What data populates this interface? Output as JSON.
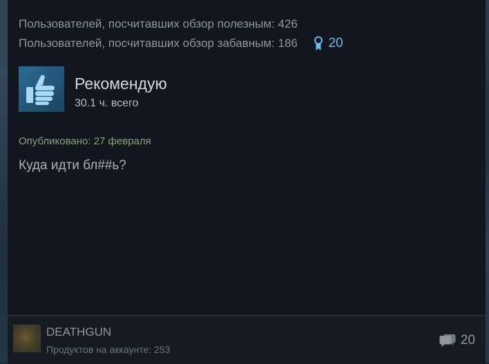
{
  "votes": {
    "helpful": "Пользователей, посчитавших обзор полезным: 426",
    "funny": "Пользователей, посчитавших обзор забавным: 186",
    "awards_count": "20",
    "award_icon": "award-ribbon-icon"
  },
  "verdict": {
    "label": "Рекомендую",
    "hours": "30.1 ч. всего",
    "icon": "thumbs-up-icon"
  },
  "review": {
    "posted": "Опубликовано: 27 февраля",
    "body": "Куда идти бл##ь?"
  },
  "author": {
    "name": "DEATHGUN",
    "products": "Продуктов на аккаунте: 253"
  },
  "comments": {
    "count": "20",
    "icon": "comments-icon"
  },
  "colors": {
    "accent": "#66c0f4",
    "card_bg": "#11161f",
    "posted_text": "#8ba377"
  }
}
